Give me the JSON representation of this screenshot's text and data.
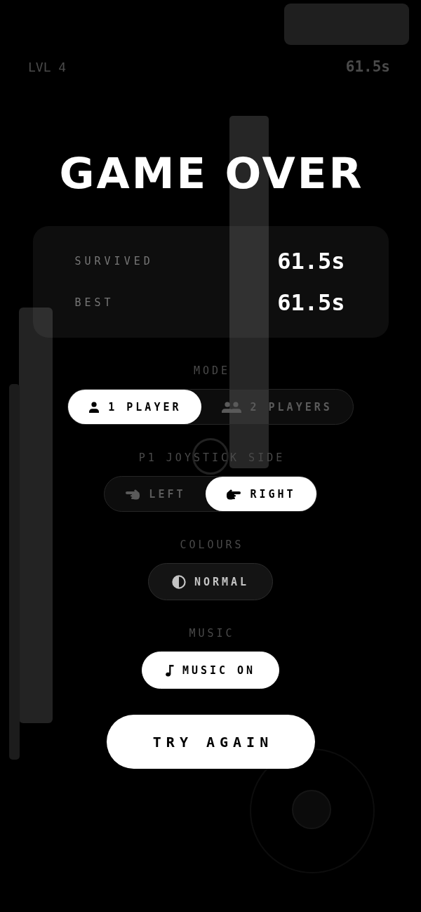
{
  "hud": {
    "level": "LVL 4",
    "timer": "61.5s"
  },
  "title": "GAME OVER",
  "stats": [
    {
      "label": "SURVIVED",
      "value": "61.5s"
    },
    {
      "label": "BEST",
      "value": "61.5s"
    }
  ],
  "settings": [
    {
      "kind": "segmented",
      "label": "MODE",
      "options": [
        {
          "label": "1 PLAYER",
          "selected": true
        },
        {
          "label": "2 PLAYERS",
          "selected": false
        }
      ]
    },
    {
      "kind": "segmented",
      "label": "P1 JOYSTICK SIDE",
      "options": [
        {
          "label": "LEFT",
          "selected": false
        },
        {
          "label": "RIGHT",
          "selected": true
        }
      ]
    },
    {
      "kind": "toggle",
      "label": "COLOURS",
      "button": {
        "label": "NORMAL",
        "on": false
      }
    },
    {
      "kind": "toggle",
      "label": "MUSIC",
      "button": {
        "label": "MUSIC ON",
        "on": true
      }
    }
  ],
  "primary_button": "TRY AGAIN"
}
